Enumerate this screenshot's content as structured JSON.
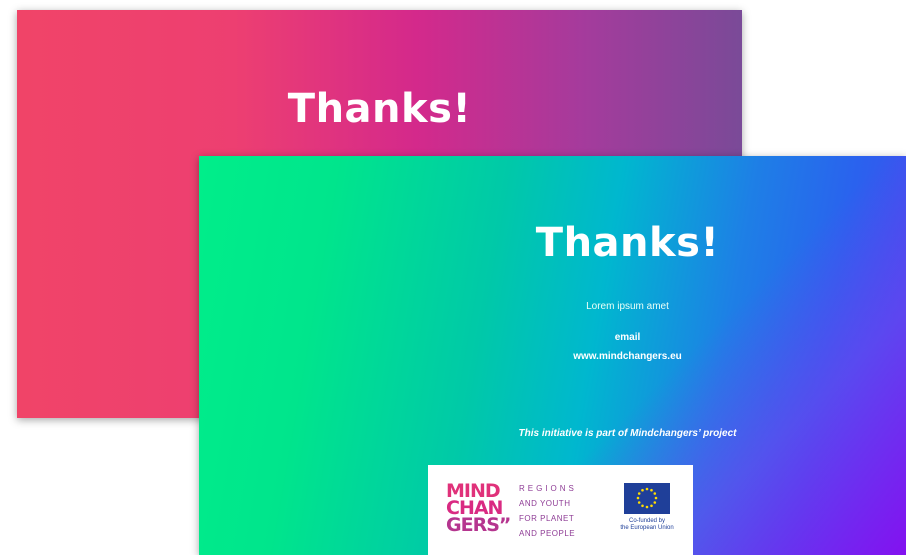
{
  "back_slide": {
    "title": "Thanks!"
  },
  "front_slide": {
    "title": "Thanks!",
    "tagline": "Lorem ipsum amet",
    "email": "email",
    "website": "www.mindchangers.eu",
    "initiative": "This initiative is part of Mindchangers’ project"
  },
  "logos": {
    "mindchangers": {
      "line1": "MIND",
      "line2": "CHAN",
      "line3": "GERS”"
    },
    "regions_lines": [
      "REGIONS",
      "AND YOUTH",
      "FOR PLANET",
      "AND PEOPLE"
    ],
    "eu_caption_line1": "Co-funded by",
    "eu_caption_line2": "the European Union"
  },
  "colors": {
    "back_gradient": [
      "#f04468",
      "#d4298b",
      "#7a4a98"
    ],
    "front_gradient": [
      "#00ee8a",
      "#00b7cf",
      "#2a62ee",
      "#9600f0"
    ],
    "logo_pink": "#e0317a",
    "logo_purple": "#8f3d96",
    "eu_blue": "#1f3f99",
    "eu_star": "#ffdd00"
  }
}
